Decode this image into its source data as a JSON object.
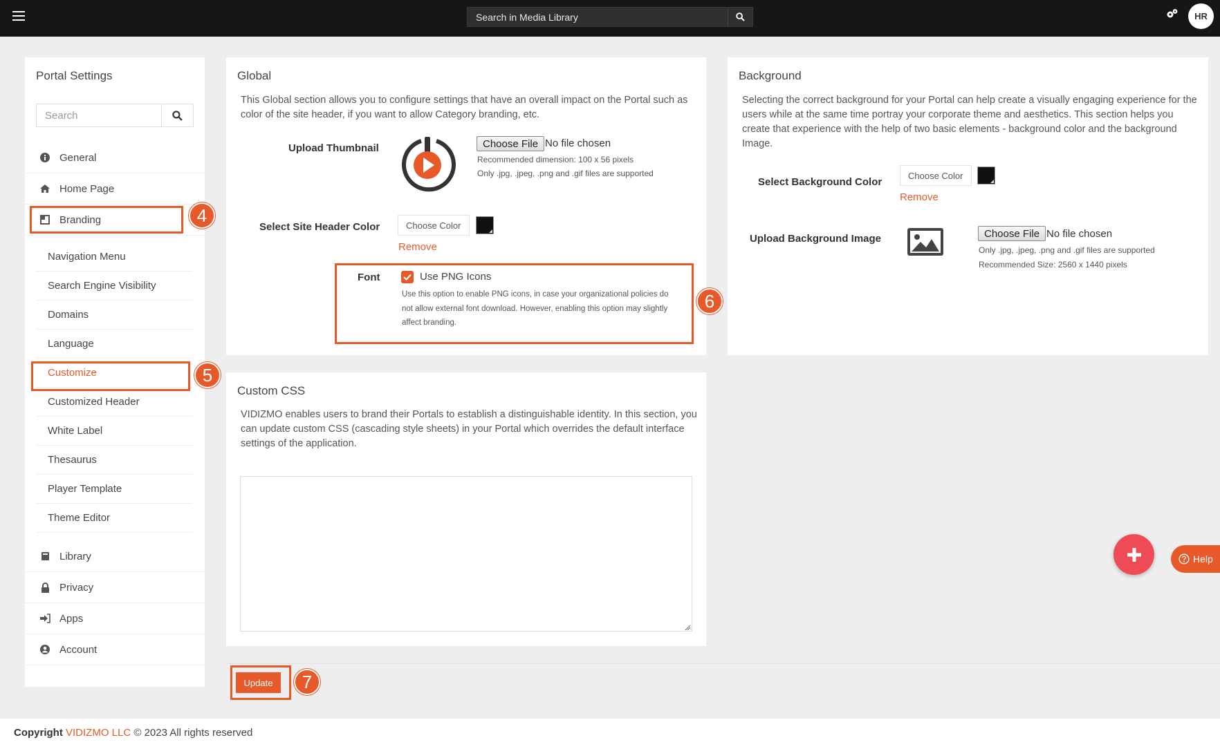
{
  "topbar": {
    "search_text": "Search in Media Library",
    "avatar_initials": "HR"
  },
  "sidebar": {
    "title": "Portal Settings",
    "search_placeholder": "Search",
    "items": [
      {
        "label": "General",
        "icon": "info-circle-icon"
      },
      {
        "label": "Home Page",
        "icon": "home-icon"
      },
      {
        "label": "Branding",
        "icon": "branding-icon"
      }
    ],
    "branding_sub": [
      {
        "label": "Navigation Menu"
      },
      {
        "label": "Search Engine Visibility"
      },
      {
        "label": "Domains"
      },
      {
        "label": "Language"
      },
      {
        "label": "Customize"
      },
      {
        "label": "Customized Header"
      },
      {
        "label": "White Label"
      },
      {
        "label": "Thesaurus"
      },
      {
        "label": "Player Template"
      },
      {
        "label": "Theme Editor"
      }
    ],
    "bottom_items": [
      {
        "label": "Library",
        "icon": "book-icon"
      },
      {
        "label": "Privacy",
        "icon": "lock-icon"
      },
      {
        "label": "Apps",
        "icon": "sign-in-icon"
      },
      {
        "label": "Account",
        "icon": "user-circle-icon"
      }
    ]
  },
  "global": {
    "title": "Global",
    "description": "This Global section allows you to configure settings that have an overall impact on the Portal such as color of the site header, if you want to allow Category branding, etc.",
    "upload_thumbnail_label": "Upload Thumbnail",
    "choose_file": "Choose File",
    "no_file": "No file chosen",
    "thumb_note_1": "Recommended dimension: 100 x 56 pixels",
    "thumb_note_2": "Only .jpg, .jpeg, .png and .gif files are supported",
    "header_color_label": "Select Site Header Color",
    "choose_color": "Choose Color",
    "remove": "Remove",
    "font_label": "Font",
    "use_png_label": "Use PNG Icons",
    "use_png_checked": true,
    "font_note": "Use this option to enable PNG icons, in case your organizational policies do not allow external font download. However, enabling this option may slightly affect branding."
  },
  "background": {
    "title": "Background",
    "description": "Selecting the correct background for your Portal can help create a visually engaging experience for the users while at the same time portray your corporate theme and aesthetics. This section helps you create that experience with the help of two basic elements - background color and the background Image.",
    "color_label": "Select Background Color",
    "choose_color": "Choose Color",
    "remove": "Remove",
    "image_label": "Upload Background Image",
    "choose_file": "Choose File",
    "no_file": "No file chosen",
    "note_1": "Only .jpg, .jpeg, .png and .gif files are supported",
    "note_2": "Recommended Size: 2560 x 1440 pixels"
  },
  "custom_css": {
    "title": "Custom CSS",
    "description": "VIDIZMO enables users to brand their Portals to establish a distinguishable identity. In this section, you can update custom CSS (cascading style sheets) in your Portal which overrides the default interface settings of the application.",
    "value": ""
  },
  "update_label": "Update",
  "help_label": "Help",
  "badges": [
    "4",
    "5",
    "6",
    "7"
  ],
  "footer": {
    "prefix": "Copyright",
    "brand": "VIDIZMO LLC",
    "suffix": "© 2023 All rights reserved"
  },
  "colors": {
    "accent": "#e8592a",
    "topbar": "#161616",
    "fab": "#ee4b57",
    "header_color_value": "#111111",
    "background_color_value": "#111111"
  }
}
